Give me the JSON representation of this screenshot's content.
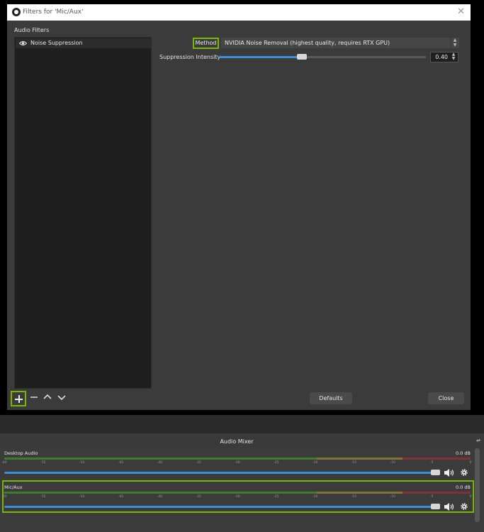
{
  "window": {
    "title": "Filters for 'Mic/Aux'",
    "close_glyph": "✕"
  },
  "filters": {
    "section_label": "Audio Filters",
    "items": [
      {
        "name": "Noise Suppression",
        "visible": true
      }
    ]
  },
  "properties": {
    "method_label": "Method",
    "method_value": "NVIDIA Noise Removal (highest quality, requires RTX GPU)",
    "intensity_label": "Suppression Intensity",
    "intensity_value": "0.40",
    "intensity_fraction": 0.4
  },
  "buttons": {
    "defaults": "Defaults",
    "close": "Close"
  },
  "mixer": {
    "title": "Audio Mixer",
    "tick_labels": [
      "-60",
      "-55",
      "-50",
      "-45",
      "-40",
      "-35",
      "-30",
      "-25",
      "-20",
      "-15",
      "-10",
      "-5",
      "0"
    ],
    "channels": [
      {
        "name": "Desktop Audio",
        "db": "0.0 dB",
        "volume_fraction": 1.0
      },
      {
        "name": "Mic/Aux",
        "db": "0.0 dB",
        "volume_fraction": 1.0
      }
    ]
  },
  "colors": {
    "highlight": "#76b900",
    "accent": "#3e8ed9"
  }
}
